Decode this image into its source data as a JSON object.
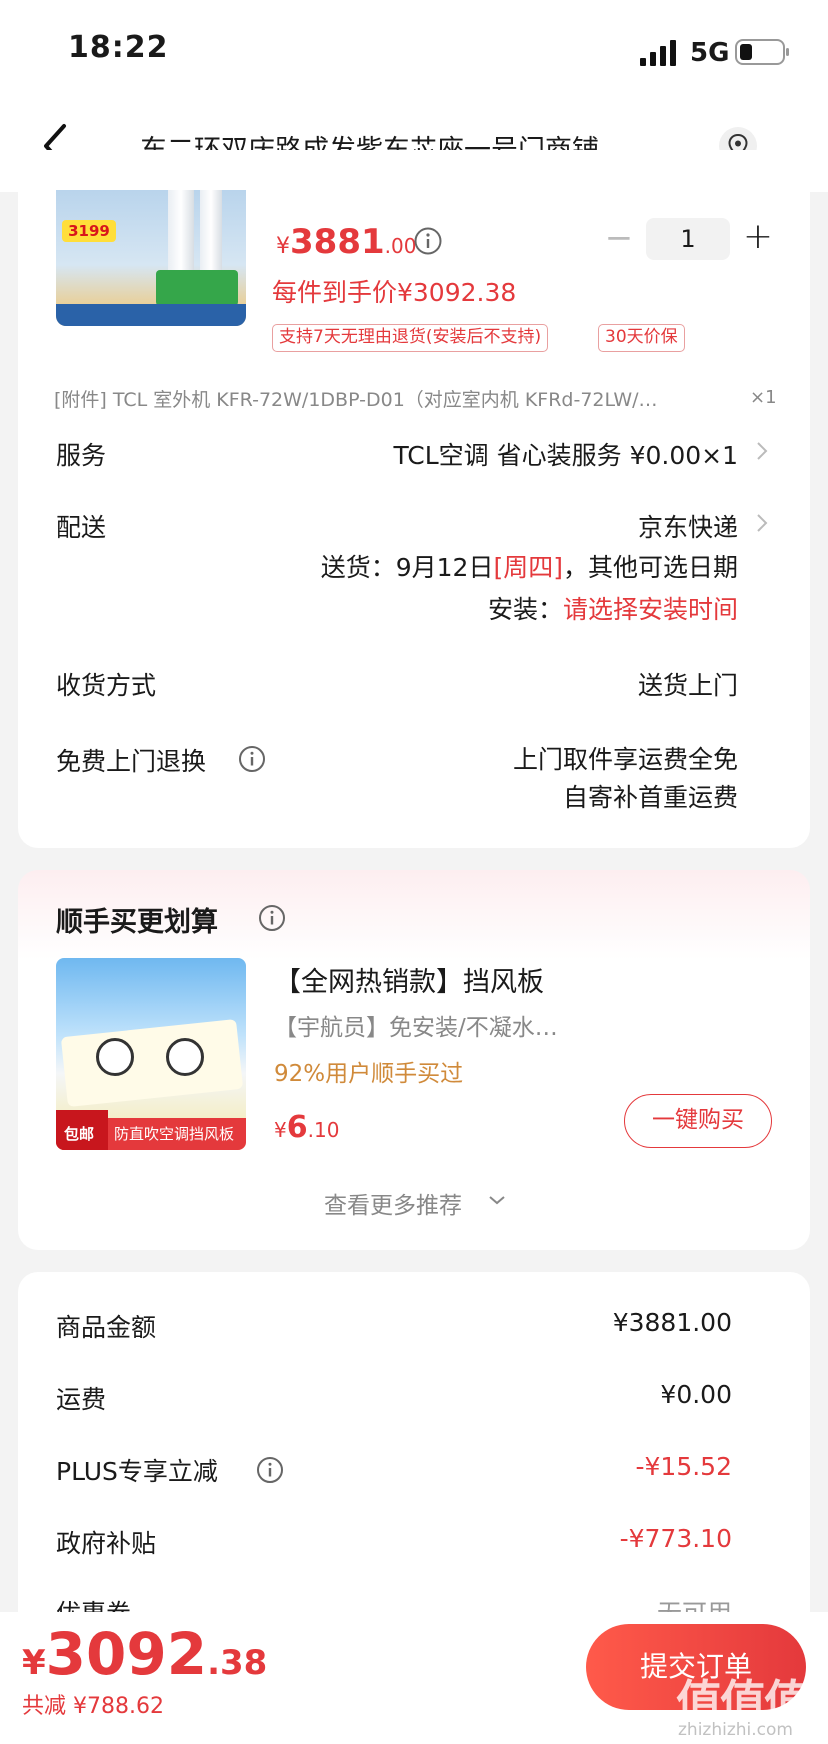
{
  "status_bar": {
    "time": "18:22",
    "network": "5G"
  },
  "nav": {
    "title": "东二环双庆路成发紫东芯座一号门商铺…"
  },
  "product": {
    "thumb_price": "3199",
    "price_symbol": "¥",
    "price_int": "3881",
    "price_dec": ".00",
    "final_price": "每件到手价¥3092.38",
    "quantity": "1",
    "tags": [
      "支持7天无理由退货(安装后不支持)",
      "30天价保"
    ],
    "accessory": "[附件] TCL 室外机 KFR-72W/1DBP-D01（对应室内机 KFRd-72LW/…",
    "accessory_qty": "×1"
  },
  "service": {
    "label": "服务",
    "value": "TCL空调 省心装服务 ¥0.00×1"
  },
  "delivery": {
    "label": "配送",
    "carrier": "京东快递",
    "date_prefix": "送货：9月12日",
    "weekday": "[周四]",
    "date_suffix": "，其他可选日期",
    "install_prefix": "安装：",
    "install_value": "请选择安装时间"
  },
  "receipt": {
    "label": "收货方式",
    "value": "送货上门"
  },
  "free_return": {
    "label": "免费上门退换",
    "line1": "上门取件享运费全免",
    "line2": "自寄补首重运费"
  },
  "recommend": {
    "title": "顺手买更划算",
    "name": "【全网热销款】挡风板",
    "desc": "【宇航员】免安装/不凝水…",
    "bought": "92%用户顺手买过",
    "price_symbol": "¥",
    "price_int": "6",
    "price_dec": ".10",
    "buy_label": "一键购买",
    "more_label": "查看更多推荐",
    "thumb_badge": "包邮",
    "thumb_caption": "防直吹空调挡风板"
  },
  "summary": {
    "rows": [
      {
        "label": "商品金额",
        "value": "¥3881.00"
      },
      {
        "label": "运费",
        "value": "¥0.00"
      },
      {
        "label": "PLUS专享立减",
        "value": "-¥15.52"
      },
      {
        "label": "政府补贴",
        "value": "-¥773.10"
      },
      {
        "label": "优惠券",
        "value": "无可用"
      }
    ]
  },
  "bottom": {
    "price_symbol": "¥",
    "price_int": "3092",
    "price_dec": ".38",
    "saved": "共减 ¥788.62",
    "submit_label": "提交订单"
  },
  "watermark": {
    "mark": "值值值",
    "url": "zhizhizhi.com"
  },
  "colors": {
    "accent": "#e4393c",
    "orange": "#d08a3a"
  }
}
